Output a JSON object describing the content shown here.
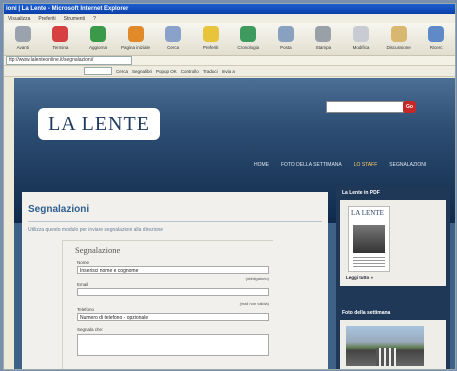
{
  "window": {
    "title": "ioni | La Lente - Microsoft Internet Explorer"
  },
  "menu": [
    "Visualizza",
    "Preferiti",
    "Strumenti",
    "?"
  ],
  "toolbar": [
    {
      "label": "Avanti",
      "color": "#9aa2ad",
      "icon": "forward-icon"
    },
    {
      "label": "Termina",
      "color": "#d64040",
      "icon": "stop-icon"
    },
    {
      "label": "Aggiorna",
      "color": "#3a9a4a",
      "icon": "refresh-icon"
    },
    {
      "label": "Pagina iniziale",
      "color": "#e08a2a",
      "icon": "home-icon"
    },
    {
      "label": "Cerca",
      "color": "#8aa1c9",
      "icon": "search-icon"
    },
    {
      "label": "Preferiti",
      "color": "#e8c43a",
      "icon": "favorites-icon"
    },
    {
      "label": "Cronologia",
      "color": "#3f9a5f",
      "icon": "history-icon"
    },
    {
      "label": "Posta",
      "color": "#8aa0c0",
      "icon": "mail-icon"
    },
    {
      "label": "Stampa",
      "color": "#9aa0a8",
      "icon": "print-icon"
    },
    {
      "label": "Modifica",
      "color": "#c8ccd2",
      "icon": "edit-icon"
    },
    {
      "label": "Discussione",
      "color": "#d8b870",
      "icon": "discuss-icon"
    },
    {
      "label": "Ricerc",
      "color": "#5f8ac7",
      "icon": "research-icon"
    }
  ],
  "address": {
    "url": "ttp://www.lalenteonline.it/segnalazioni/"
  },
  "links": [
    "Cerca",
    "Segnalibri",
    "Popup OK",
    "Controllo",
    "Traduci",
    "Invia a"
  ],
  "site": {
    "logo": "LA LENTE",
    "search_button": "Go",
    "nav": [
      "HOME",
      "FOTO DELLA SETTIMANA",
      "LO STAFF",
      "SEGNALAZIONI"
    ],
    "nav_active": 2,
    "page_title": "Segnalazioni",
    "intro": "Utilizza questo modulo per inviare segnalazioni alla direzione",
    "form": {
      "legend": "Segnalazione",
      "name_label": "Nome",
      "name_value": "Inserisci nome e cognome",
      "name_note": "(obbligatorio)",
      "email_label": "Email",
      "email_value": "",
      "email_note": "(mail non valida)",
      "phone_label": "Telefono",
      "phone_value": "Numero di telefono - opzionale",
      "message_label": "Segnala che:"
    },
    "sidebar": {
      "pdf_title": "La Lente in PDF",
      "pdf_logo": "LA LENTE",
      "read_all": "Leggi tutto »",
      "photo_title": "Foto della settimana"
    }
  }
}
